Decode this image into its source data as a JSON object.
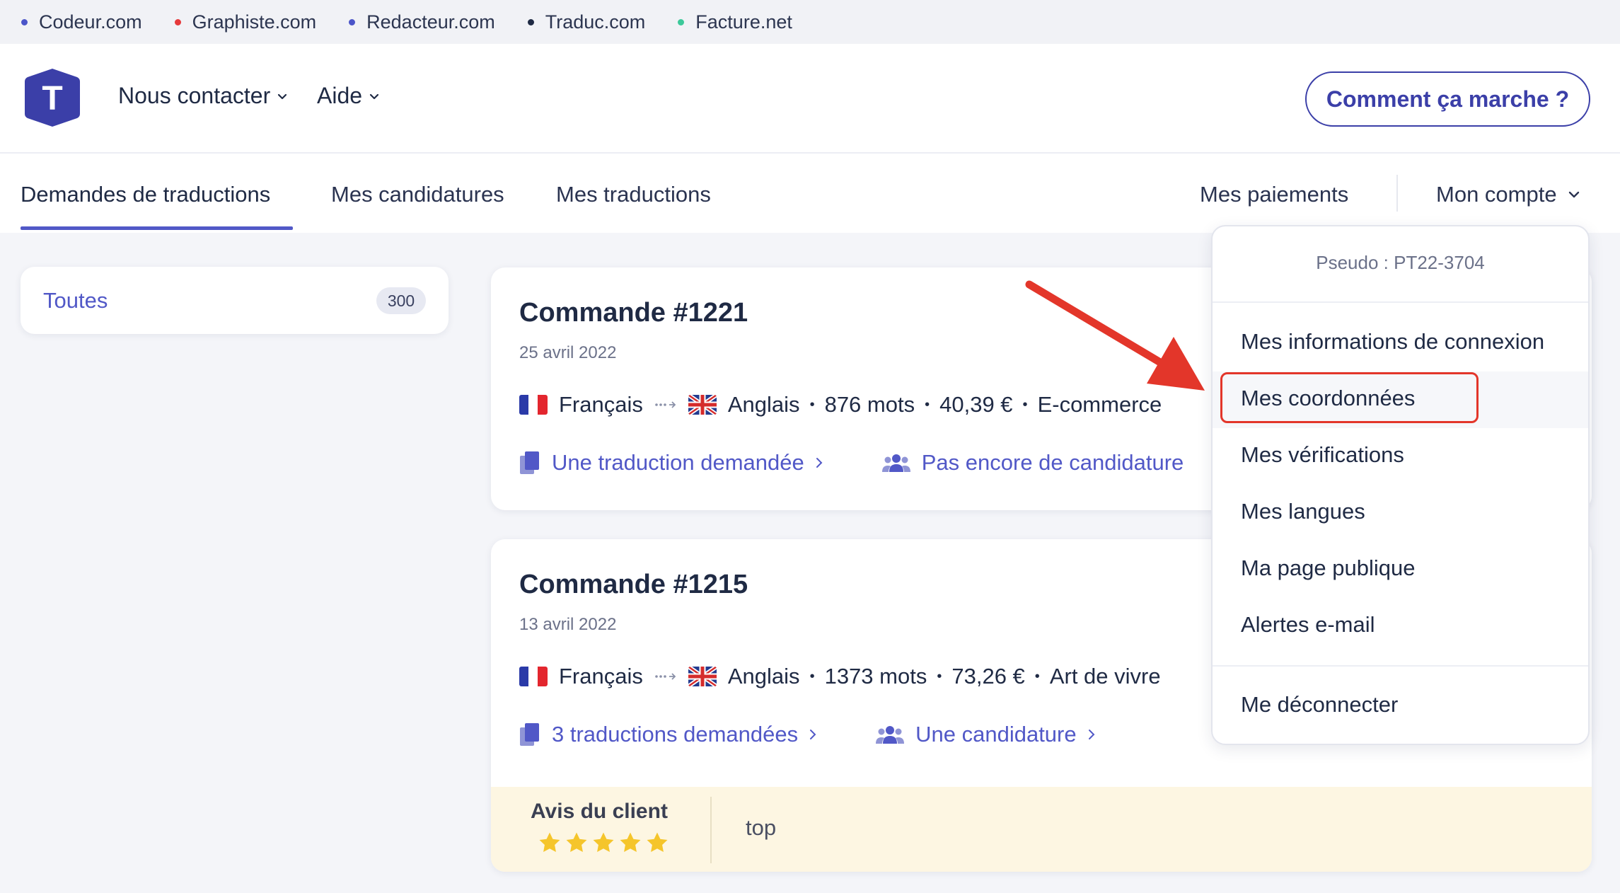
{
  "network_bar": {
    "sites": [
      {
        "label": "Codeur.com",
        "color": "#4b55c9"
      },
      {
        "label": "Graphiste.com",
        "color": "#e6393b"
      },
      {
        "label": "Redacteur.com",
        "color": "#4b55c9"
      },
      {
        "label": "Traduc.com",
        "color": "#1f2a44"
      },
      {
        "label": "Facture.net",
        "color": "#3cc99a"
      }
    ]
  },
  "header": {
    "logo_letter": "T",
    "nav": {
      "contact_label": "Nous contacter",
      "help_label": "Aide"
    },
    "cta_label": "Comment ça marche ?"
  },
  "tabs": {
    "requests": "Demandes de traductions",
    "applications": "Mes candidatures",
    "translations": "Mes traductions",
    "payments": "Mes paiements",
    "account": "Mon compte"
  },
  "filter": {
    "label": "Toutes",
    "count": "300"
  },
  "orders": [
    {
      "title": "Commande #1221",
      "date": "25 avril 2022",
      "source_lang": "Français",
      "target_lang": "Anglais",
      "words": "876 mots",
      "price": "40,39 €",
      "category": "E-commerce",
      "translations_link": "Une traduction demandée",
      "candidates_link": "Pas encore de candidature"
    },
    {
      "title": "Commande #1215",
      "date": "13 avril 2022",
      "source_lang": "Français",
      "target_lang": "Anglais",
      "words": "1373 mots",
      "price": "73,26 €",
      "category": "Art de vivre",
      "translations_link": "3 traductions demandées",
      "candidates_link": "Une candidature",
      "review": {
        "label": "Avis du client",
        "stars": 5,
        "text": "top"
      }
    }
  ],
  "account_menu": {
    "pseudo": "Pseudo : PT22-3704",
    "items": [
      "Mes informations de connexion",
      "Mes coordonnées",
      "Mes vérifications",
      "Mes langues",
      "Ma page publique",
      "Alertes e-mail"
    ],
    "logout": "Me déconnecter",
    "highlighted_item": "Mes coordonnées"
  },
  "colors": {
    "accent": "#5158c7",
    "annotation_red": "#e3362a",
    "star": "#f5c52b"
  }
}
